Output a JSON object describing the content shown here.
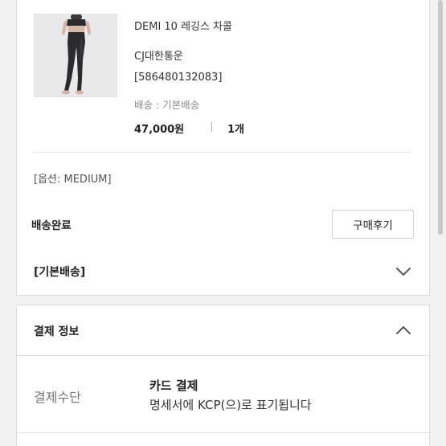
{
  "product": {
    "name": "DEMI 10 레깅스 차콜",
    "courier": "CJ대한통운",
    "tracking": "[586480132083]",
    "shipping": "배송 : 기본배송",
    "price": "47,000원",
    "quantity": "1개",
    "option": "[옵션: MEDIUM]",
    "status": "배송완료",
    "review_button": "구매후기",
    "image_icon": "leggings-product-photo"
  },
  "shipping_section": {
    "title": "[기본배송]",
    "toggle_icon": "chevron-down-icon"
  },
  "payment_section": {
    "title": "결제 정보",
    "toggle_icon": "chevron-up-icon",
    "method_label": "결제수단",
    "method_value": "카드 결제",
    "method_note": "명세서에 KCP(으)로 표기됩니다"
  },
  "colors": {
    "background": "#f2f2f2",
    "card": "#ffffff",
    "border": "#dcdcdc",
    "muted_text": "#8a8a8a",
    "photo_bg": "#e9e9e9",
    "leggings": "#2b2b2d"
  }
}
